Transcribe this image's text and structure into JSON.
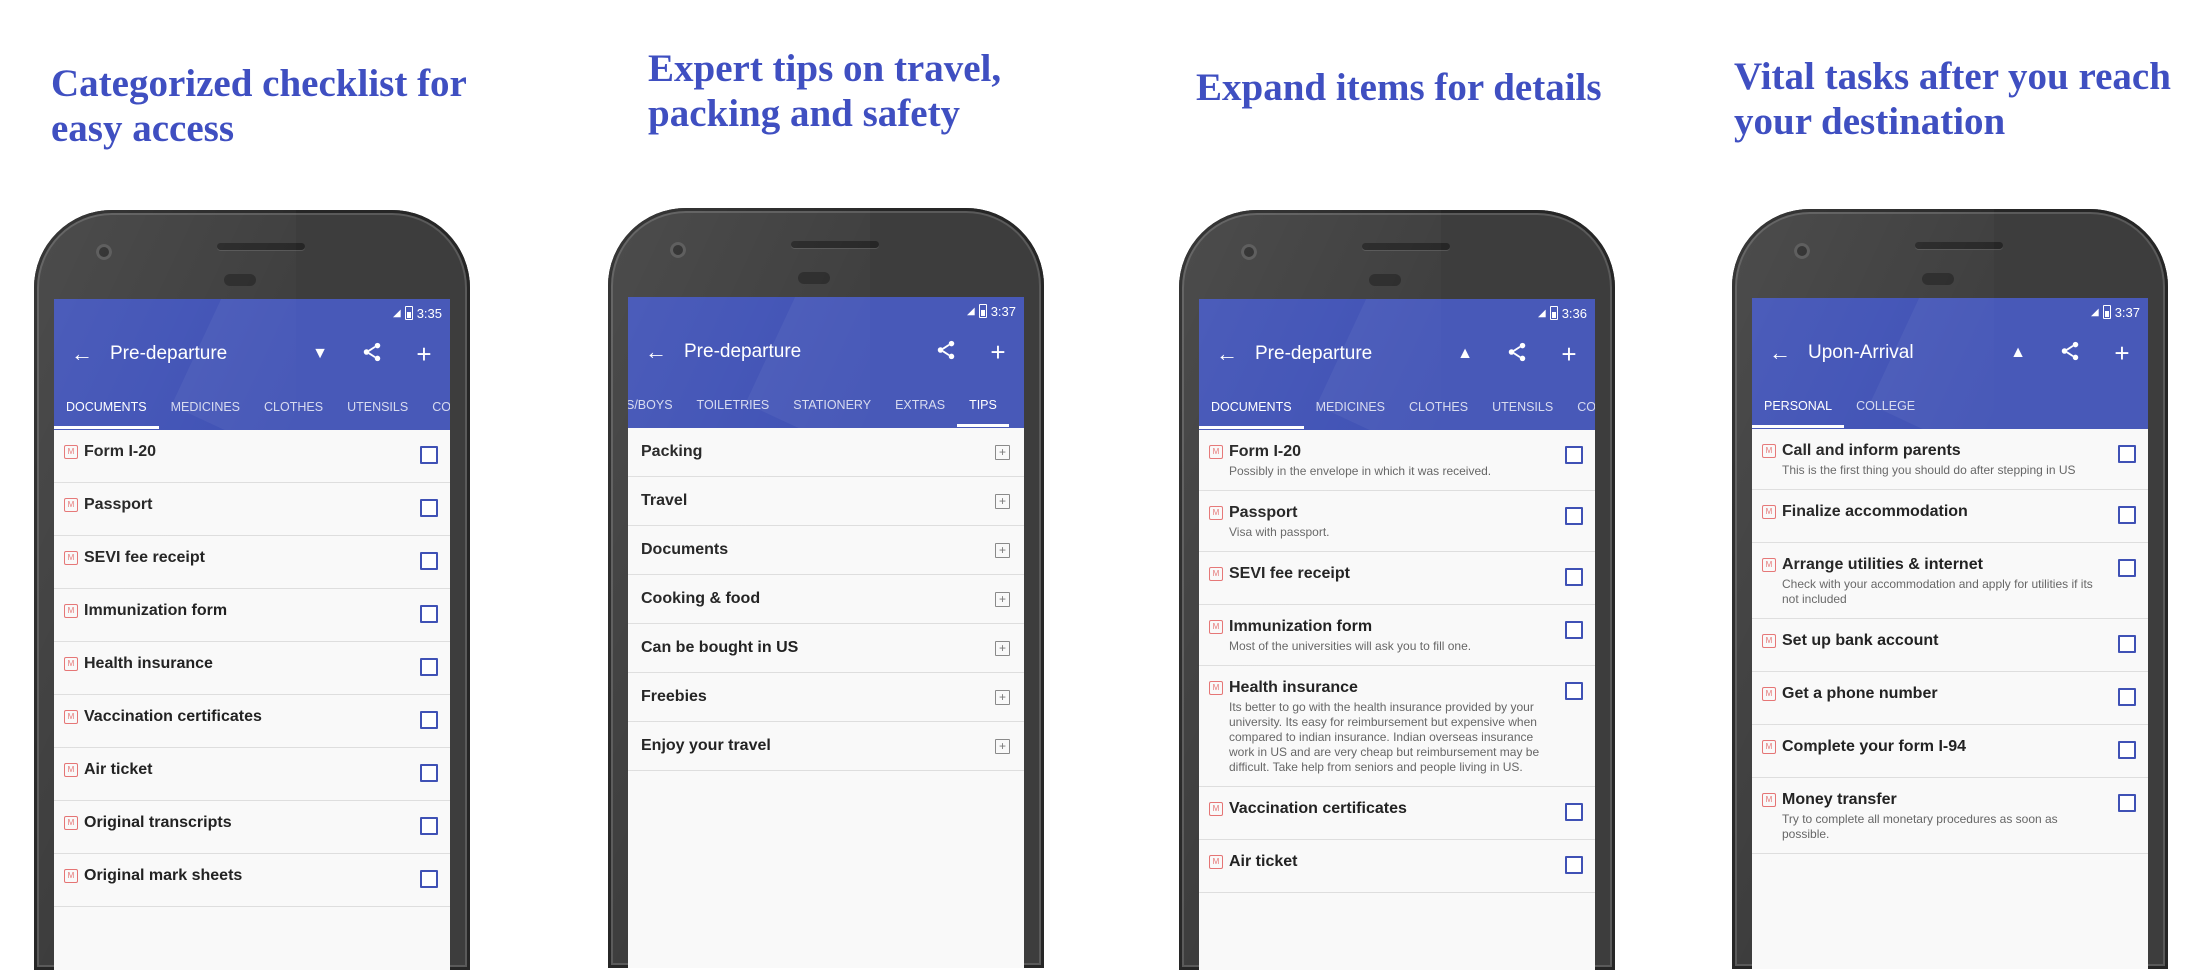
{
  "colors": {
    "caption": "#3f4fc1",
    "appbar": "#3f51b5",
    "badge": "#e57373",
    "checkbox": "#3f51b5"
  },
  "icons": {
    "back": "arrow-left-icon",
    "share": "share-icon",
    "add": "plus-icon",
    "dropdown": "triangle-down-icon",
    "collapse": "triangle-up-icon",
    "expand": "plus-square-icon",
    "must": "m-badge-icon"
  },
  "panels": [
    {
      "caption": [
        "Categorized checklist for",
        "easy access"
      ],
      "status_time": "3:35",
      "title": "Pre-departure",
      "toggle": "▼",
      "tabs": [
        {
          "label": "DOCUMENTS",
          "active": true
        },
        {
          "label": "MEDICINES"
        },
        {
          "label": "CLOTHES"
        },
        {
          "label": "UTENSILS"
        },
        {
          "label": "CO"
        }
      ],
      "items": [
        {
          "text": "Form I-20"
        },
        {
          "text": "Passport"
        },
        {
          "text": "SEVI fee receipt"
        },
        {
          "text": "Immunization form"
        },
        {
          "text": "Health insurance"
        },
        {
          "text": "Vaccination certificates"
        },
        {
          "text": "Air ticket"
        },
        {
          "text": "Original transcripts"
        },
        {
          "text": "Original mark sheets"
        }
      ]
    },
    {
      "caption": [
        "Expert tips on travel,",
        "packing and safety"
      ],
      "status_time": "3:37",
      "title": "Pre-departure",
      "tabs": [
        {
          "label": "S/BOYS"
        },
        {
          "label": "TOILETRIES"
        },
        {
          "label": "STATIONERY"
        },
        {
          "label": "EXTRAS"
        },
        {
          "label": "TIPS",
          "active": true
        }
      ],
      "tips": [
        "Packing",
        "Travel",
        "Documents",
        "Cooking & food",
        "Can be bought in US",
        "Freebies",
        "Enjoy your travel"
      ]
    },
    {
      "caption": [
        "Expand items for details"
      ],
      "status_time": "3:36",
      "title": "Pre-departure",
      "toggle": "▲",
      "tabs": [
        {
          "label": "DOCUMENTS",
          "active": true
        },
        {
          "label": "MEDICINES"
        },
        {
          "label": "CLOTHES"
        },
        {
          "label": "UTENSILS"
        },
        {
          "label": "CO"
        }
      ],
      "items": [
        {
          "text": "Form I-20",
          "sub": "Possibly in the envelope in which it was received."
        },
        {
          "text": "Passport",
          "sub": "Visa with passport."
        },
        {
          "text": "SEVI fee receipt"
        },
        {
          "text": "Immunization form",
          "sub": "Most of the universities will ask you to fill one."
        },
        {
          "text": "Health insurance",
          "sub": "Its better to go with the health insurance provided by your university. Its easy for reimbursement but expensive when compared to indian insurance. Indian overseas insurance work in US and are very cheap but reimbursement may be difficult. Take help from seniors and people living in US."
        },
        {
          "text": "Vaccination certificates"
        },
        {
          "text": "Air ticket"
        }
      ]
    },
    {
      "caption": [
        "Vital tasks after you reach",
        "your destination"
      ],
      "status_time": "3:37",
      "title": "Upon-Arrival",
      "toggle": "▲",
      "tabs": [
        {
          "label": "PERSONAL",
          "active": true
        },
        {
          "label": "COLLEGE"
        }
      ],
      "items": [
        {
          "text": "Call and inform parents",
          "sub": "This is the first thing you should do after stepping in US"
        },
        {
          "text": "Finalize accommodation"
        },
        {
          "text": "Arrange utilities & internet",
          "sub": "Check with your accommodation and apply for utilities if its not included"
        },
        {
          "text": "Set up bank account"
        },
        {
          "text": "Get a phone number"
        },
        {
          "text": "Complete your form I-94"
        },
        {
          "text": "Money transfer",
          "sub": "Try to complete all monetary procedures as soon as possible."
        }
      ]
    }
  ]
}
